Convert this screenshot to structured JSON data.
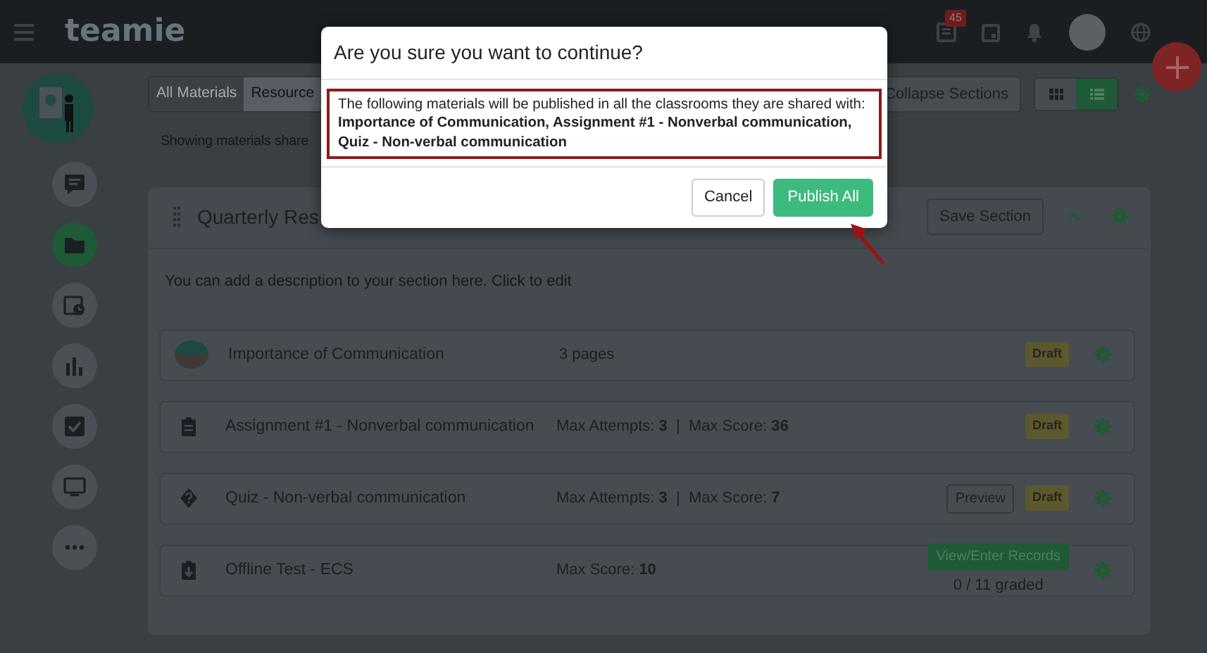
{
  "navbar": {
    "logo": "teamie",
    "notification_count": "45"
  },
  "toolbar": {
    "tabs": [
      {
        "label": "All Materials",
        "selected": true
      },
      {
        "label": "Resource",
        "selected": false
      }
    ],
    "collapse_button": "Collapse Sections",
    "view_toggles": [
      {
        "kind": "grid",
        "selected": false
      },
      {
        "kind": "list",
        "selected": true
      }
    ]
  },
  "filter_note": "Showing materials share",
  "side_nav": [
    {
      "kind": "chat",
      "selected": false
    },
    {
      "kind": "folder",
      "selected": true
    },
    {
      "kind": "calendar",
      "selected": false
    },
    {
      "kind": "chart",
      "selected": false
    },
    {
      "kind": "check",
      "selected": false
    },
    {
      "kind": "monitor",
      "selected": false
    },
    {
      "kind": "more",
      "selected": false
    }
  ],
  "section": {
    "title": "Quarterly Res",
    "save_button": "Save Section",
    "description": "You can add a description to your section here. Click to edit",
    "materials": [
      {
        "kind": "page",
        "title": "Importance of Communication",
        "meta": "3 pages",
        "status": "Draft"
      },
      {
        "kind": "assignment",
        "title": "Assignment #1 - Nonverbal communication",
        "meta": "Max Attempts: **3**  |  Max Score: **36**",
        "status": "Draft"
      },
      {
        "kind": "quiz",
        "title": "Quiz - Non-verbal communication",
        "meta": "Max Attempts: **3**  |  Max Score: **7**",
        "preview_button": "Preview",
        "status": "Draft"
      },
      {
        "kind": "offline",
        "title": "Offline Test - ECS",
        "meta": "Max Score: **10**",
        "records_button": "View/Enter Records",
        "graded": "0 / 11 graded"
      }
    ]
  },
  "dialog": {
    "title": "Are you sure you want to continue?",
    "message": "The following materials will be published in all the classrooms they are shared with: **Importance of Communication, Assignment #1 - Nonverbal communication, Quiz - Non-verbal communication**",
    "buttons": [
      {
        "kind": "secondary",
        "label": "Cancel"
      },
      {
        "kind": "primary",
        "label": "Publish All"
      }
    ]
  }
}
